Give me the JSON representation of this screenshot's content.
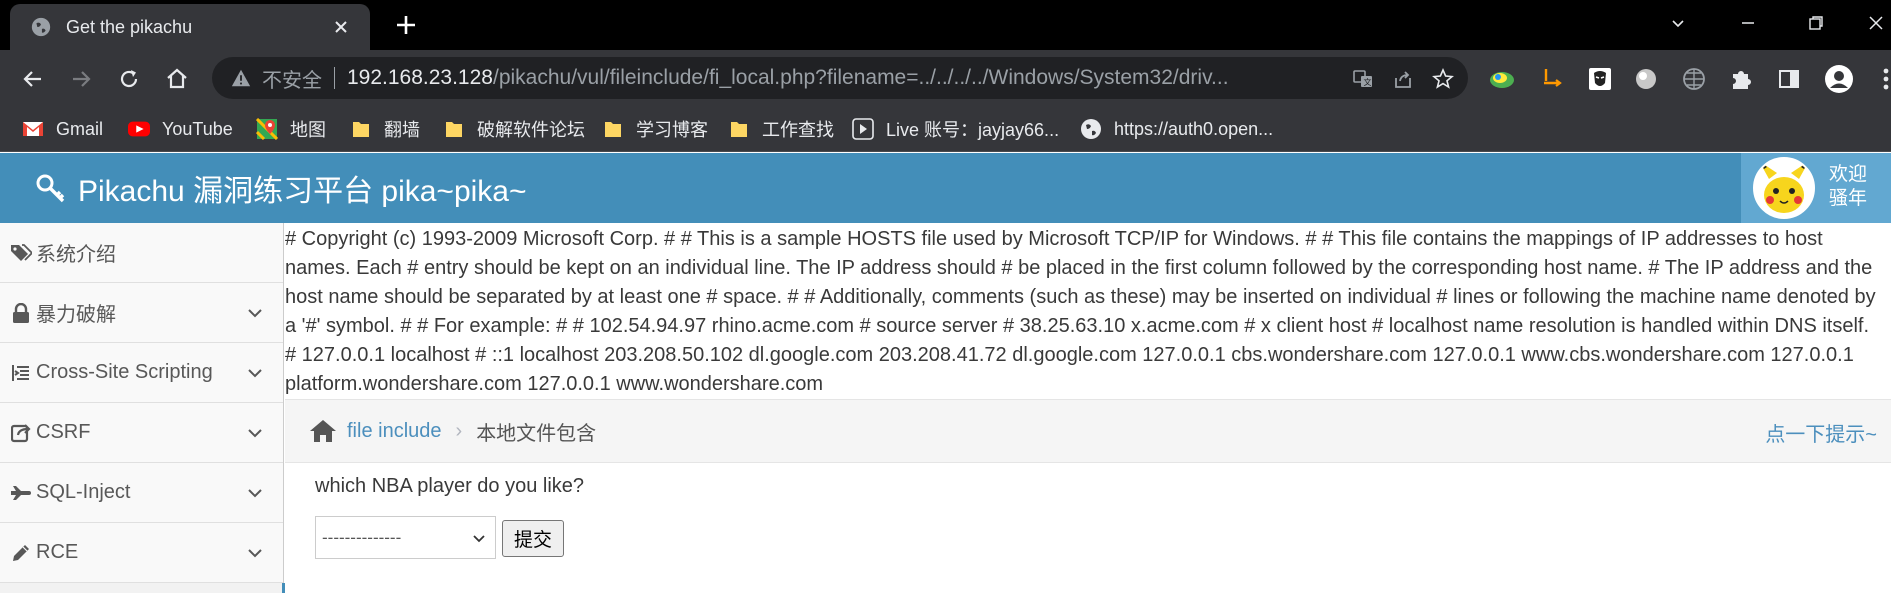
{
  "browser": {
    "tab": {
      "title": "Get the pikachu"
    },
    "omnibox": {
      "security_label": "不安全",
      "url_host": "192.168.23.128",
      "url_path": "/pikachu/vul/fileinclude/fi_local.php?filename=../../../../Windows/System32/driv..."
    },
    "bookmarks": [
      {
        "label": "Gmail",
        "icon": "gmail-icon"
      },
      {
        "label": "YouTube",
        "icon": "youtube-icon"
      },
      {
        "label": "地图",
        "icon": "maps-icon"
      },
      {
        "label": "翻墙",
        "icon": "folder-icon"
      },
      {
        "label": "破解软件论坛",
        "icon": "folder-icon"
      },
      {
        "label": "学习博客",
        "icon": "folder-icon"
      },
      {
        "label": "工作查找",
        "icon": "folder-icon"
      },
      {
        "label": "Live  账号：jayjay66...",
        "icon": "live-icon"
      },
      {
        "label": "https://auth0.open...",
        "icon": "globe-icon"
      }
    ],
    "colors": {
      "tabbar": "#000000",
      "toolbar": "#35363a",
      "omnibox": "#202124"
    }
  },
  "header": {
    "title": "Pikachu 漏洞练习平台 pika~pika~",
    "welcome": "欢迎",
    "username": "骚年",
    "color": "#438eb9"
  },
  "sidebar": {
    "items": [
      {
        "label": "系统介绍",
        "icon": "tags-icon",
        "has_chevron": false
      },
      {
        "label": "暴力破解",
        "icon": "lock-icon",
        "has_chevron": true
      },
      {
        "label": "Cross-Site Scripting",
        "icon": "list-indent-icon",
        "has_chevron": true
      },
      {
        "label": "CSRF",
        "icon": "share-icon",
        "has_chevron": true
      },
      {
        "label": "SQL-Inject",
        "icon": "plane-icon",
        "has_chevron": true
      },
      {
        "label": "RCE",
        "icon": "pencil-icon",
        "has_chevron": true
      }
    ]
  },
  "main": {
    "hosts_text": "# Copyright (c) 1993-2009 Microsoft Corp. # # This is a sample HOSTS file used by Microsoft TCP/IP for Windows. # # This file contains the mappings of IP addresses to host names. Each # entry should be kept on an individual line. The IP address should # be placed in the first column followed by the corresponding host name. # The IP address and the host name should be separated by at least one # space. # # Additionally, comments (such as these) may be inserted on individual # lines or following the machine name denoted by a '#' symbol. # # For example: # # 102.54.94.97 rhino.acme.com # source server # 38.25.63.10 x.acme.com # x client host # localhost name resolution is handled within DNS itself. # 127.0.0.1 localhost # ::1 localhost 203.208.50.102 dl.google.com 203.208.41.72 dl.google.com 127.0.0.1 cbs.wondershare.com 127.0.0.1 www.cbs.wondershare.com 127.0.0.1 platform.wondershare.com 127.0.0.1 www.wondershare.com",
    "breadcrumb": {
      "link": "file include",
      "separator": "›",
      "current": "本地文件包含",
      "tip": "点一下提示~"
    },
    "form": {
      "question": "which NBA player do you like?",
      "select_value": "--------------",
      "submit_label": "提交"
    }
  }
}
